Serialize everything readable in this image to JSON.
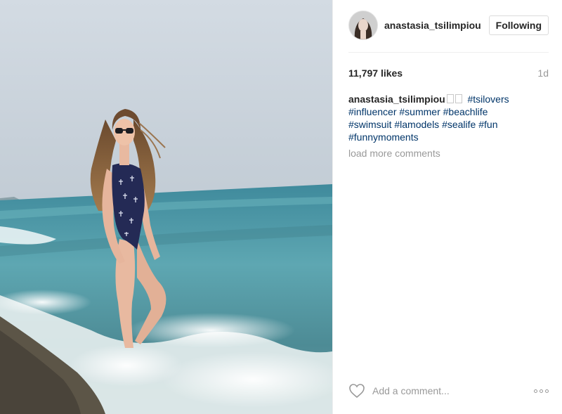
{
  "post": {
    "username": "anastasia_tsilimpiou",
    "follow_label": "Following",
    "likes": "11,797 likes",
    "time_ago": "1d",
    "caption": {
      "username": "anastasia_tsilimpiou",
      "tags": [
        "#tsilovers",
        "#influencer",
        "#summer",
        "#beachlife",
        "#swimsuit",
        "#lamodels",
        "#sealife",
        "#fun",
        "#funnymoments"
      ]
    },
    "load_more_label": "load more comments",
    "comment_placeholder": "Add a comment..."
  },
  "icons": {
    "like": "heart-icon",
    "more": "more-options-icon",
    "avatar": "avatar"
  },
  "colors": {
    "hashtag": "#003569",
    "muted": "#999999",
    "text": "#262626",
    "border": "#dbdbdb"
  }
}
